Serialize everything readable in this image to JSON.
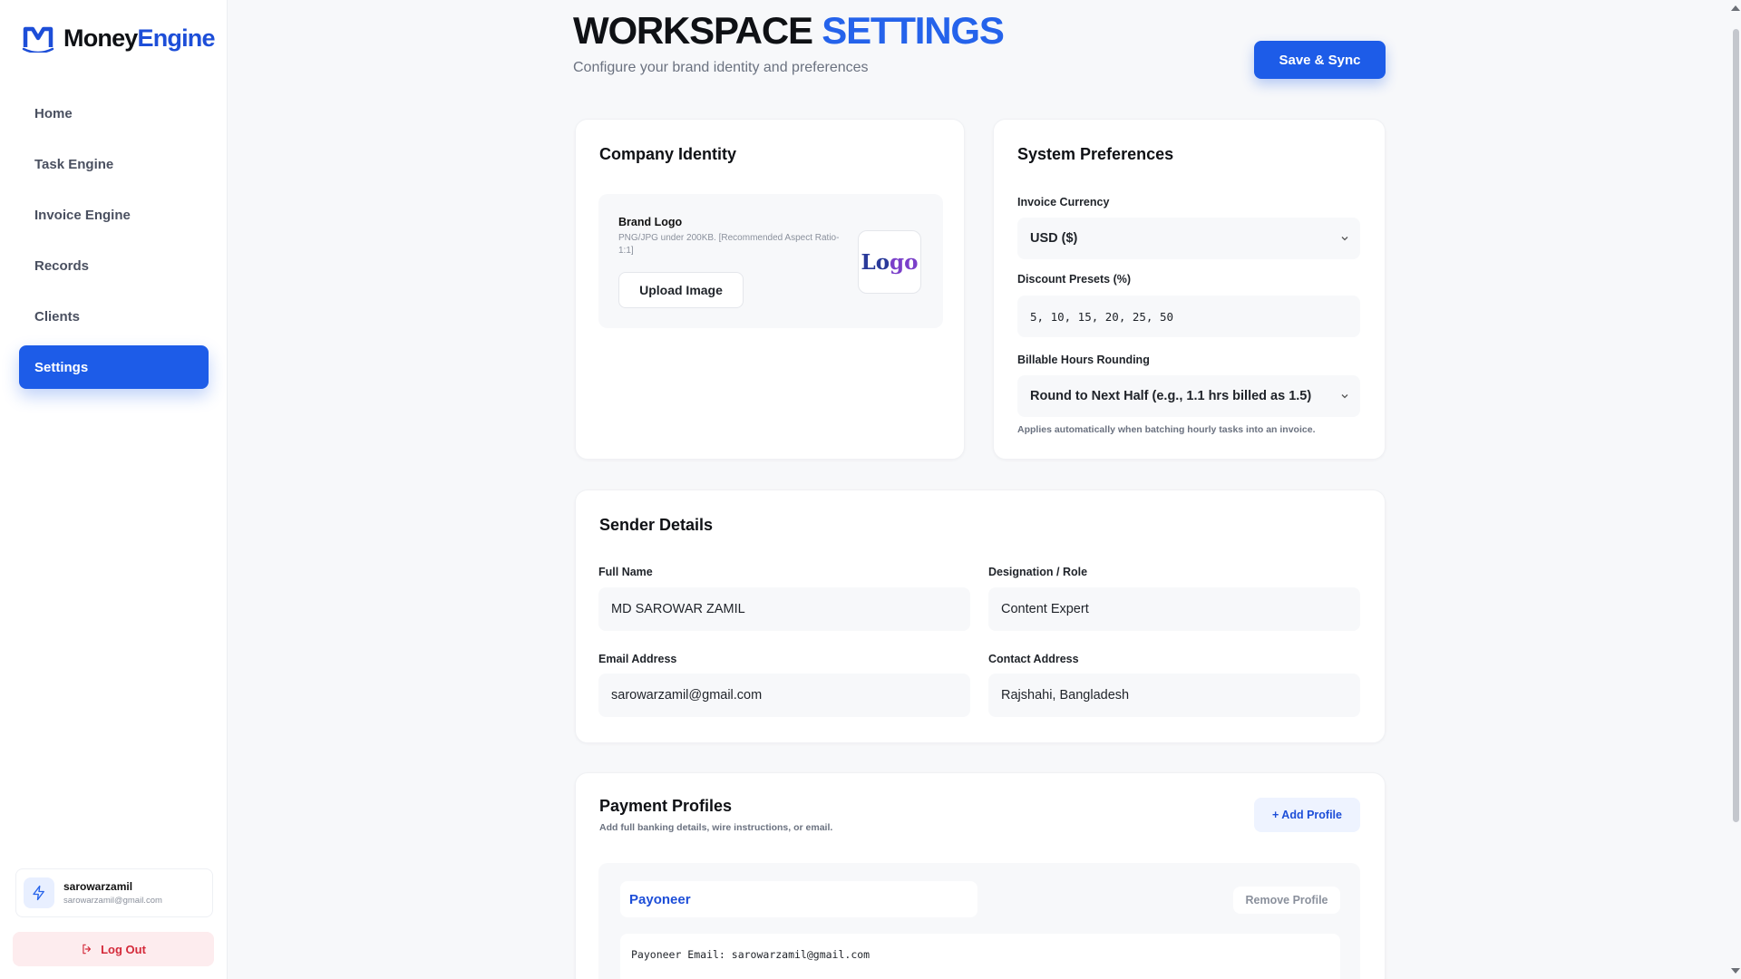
{
  "brand": {
    "name_part1": "Money",
    "name_part2": "Engine"
  },
  "sidebar": {
    "items": [
      {
        "label": "Home"
      },
      {
        "label": "Task Engine"
      },
      {
        "label": "Invoice Engine"
      },
      {
        "label": "Records"
      },
      {
        "label": "Clients"
      },
      {
        "label": "Settings",
        "active": true
      }
    ],
    "user": {
      "name": "sarowarzamil",
      "email": "sarowarzamil@gmail.com"
    },
    "logout_label": "Log Out"
  },
  "header": {
    "title_part1": "WORKSPACE",
    "title_part2": "SETTINGS",
    "subtitle": "Configure your brand identity and preferences",
    "save_label": "Save & Sync"
  },
  "company_identity": {
    "title": "Company Identity",
    "brand_logo_title": "Brand Logo",
    "brand_logo_help": "PNG/JPG under 200KB. [Recommended Aspect Ratio- 1:1]",
    "upload_label": "Upload Image",
    "logo_preview_part1": "Lo",
    "logo_preview_part2": "go"
  },
  "system_preferences": {
    "title": "System Preferences",
    "currency_label": "Invoice Currency",
    "currency_value": "USD ($)",
    "discount_label": "Discount Presets (%)",
    "discount_value": "5, 10, 15, 20, 25, 50",
    "rounding_label": "Billable Hours Rounding",
    "rounding_value": "Round to Next Half (e.g., 1.1 hrs billed as 1.5)",
    "rounding_help": "Applies automatically when batching hourly tasks into an invoice."
  },
  "sender_details": {
    "title": "Sender Details",
    "full_name_label": "Full Name",
    "full_name_value": "MD SAROWAR ZAMIL",
    "designation_label": "Designation / Role",
    "designation_value": "Content Expert",
    "email_label": "Email Address",
    "email_value": "sarowarzamil@gmail.com",
    "address_label": "Contact Address",
    "address_value": "Rajshahi, Bangladesh"
  },
  "payment_profiles": {
    "title": "Payment Profiles",
    "subtitle": "Add full banking details, wire instructions, or email.",
    "add_label": "+ Add Profile",
    "profiles": [
      {
        "name": "Payoneer",
        "remove_label": "Remove Profile",
        "details": "Payoneer Email: sarowarzamil@gmail.com"
      }
    ]
  },
  "colors": {
    "accent": "#1d5ce8",
    "danger": "#d42a3a",
    "background": "#f7f8fa"
  },
  "icons": {
    "brand": "money-engine-m-logo",
    "avatar": "lightning-icon",
    "logout": "logout-icon",
    "dropdown": "chevron-down-icon"
  }
}
